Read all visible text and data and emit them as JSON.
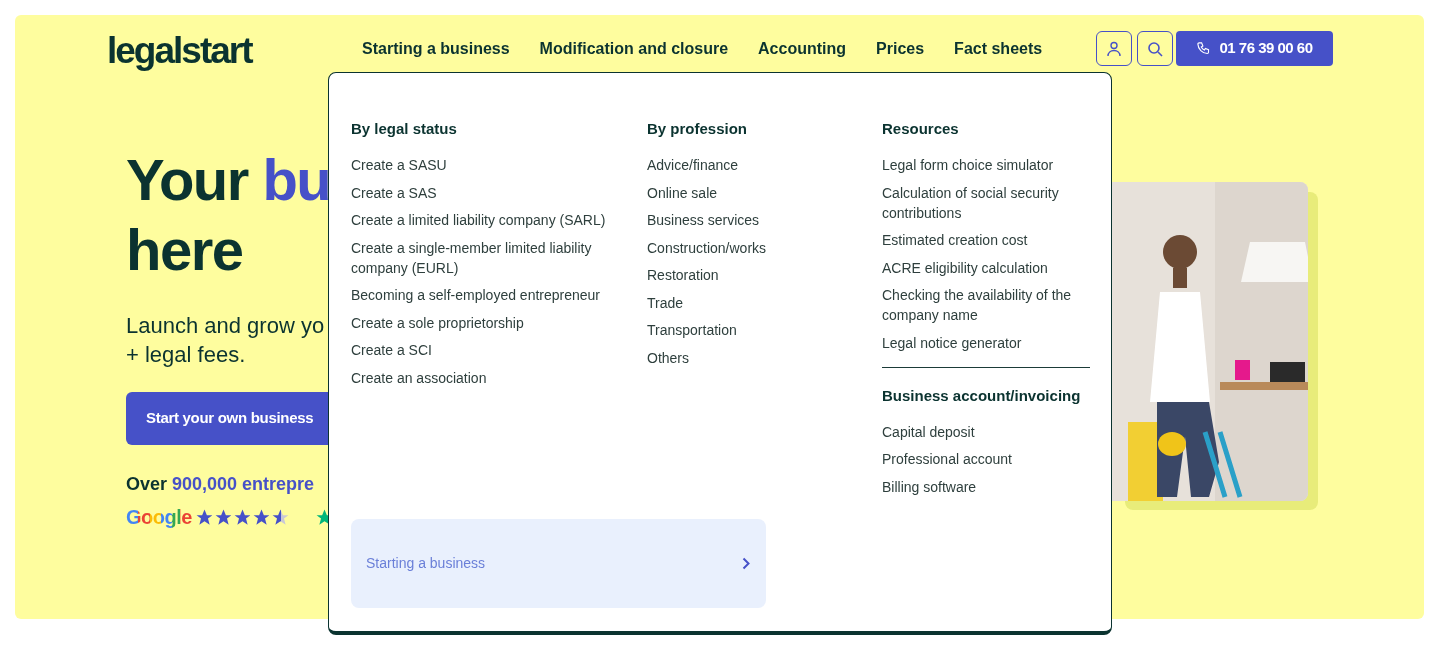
{
  "header": {
    "logo": "legalstart",
    "nav": [
      "Starting a business",
      "Modification and closure",
      "Accounting",
      "Prices",
      "Fact sheets"
    ],
    "phone": "01 76 39 00 60"
  },
  "hero": {
    "title_lines": [
      "Your **bu**",
      "here"
    ],
    "subtitle_lines": [
      "Launch and grow yo",
      "+ legal fees."
    ],
    "cta": "Start your own business",
    "proof": "Over **900,000 entrepre**",
    "google": "Google",
    "stars": 4.5
  },
  "menu": {
    "columns": [
      {
        "heading": "By legal status",
        "items": [
          "Create a SASU",
          "Create a SAS",
          "Create a limited liability company (SARL)",
          "Create a single-member limited liability company (EURL)",
          "Becoming a self-employed entrepreneur",
          "Create a sole proprietorship",
          "Create a SCI",
          "Create an association"
        ]
      },
      {
        "heading": "By profession",
        "items": [
          "Advice/finance",
          "Online sale",
          "Business services",
          "Construction/works",
          "Restoration",
          "Trade",
          "Transportation",
          "Others"
        ]
      },
      {
        "heading": "Resources",
        "items": [
          "Legal form choice simulator",
          "Calculation of social security contributions",
          "Estimated creation cost",
          "ACRE eligibility calculation",
          "Checking the availability of the company name",
          "Legal notice generator"
        ]
      },
      {
        "heading": "Business account/invoicing",
        "items": [
          "Capital deposit",
          "Professional account",
          "Billing software"
        ]
      }
    ],
    "footer_link": "Starting a business"
  }
}
